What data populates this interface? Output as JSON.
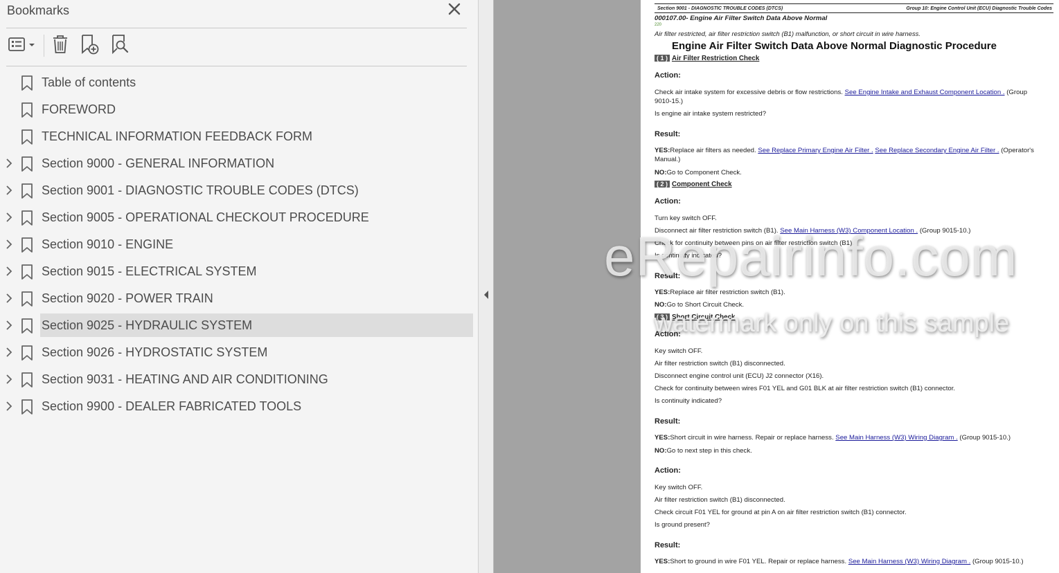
{
  "bookmarks_panel": {
    "title": "Bookmarks",
    "toolbar": {
      "options_icon": "list-options-icon",
      "delete_icon": "trash-icon",
      "add_icon": "add-bookmark-icon",
      "find_icon": "find-bookmark-icon"
    },
    "items": [
      {
        "label": "Table of contents",
        "expandable": false,
        "selected": false
      },
      {
        "label": "FOREWORD",
        "expandable": false,
        "selected": false
      },
      {
        "label": "TECHNICAL INFORMATION FEEDBACK FORM",
        "expandable": false,
        "selected": false
      },
      {
        "label": "Section 9000 - GENERAL INFORMATION",
        "expandable": true,
        "selected": false
      },
      {
        "label": "Section 9001 - DIAGNOSTIC TROUBLE CODES (DTCS)",
        "expandable": true,
        "selected": false
      },
      {
        "label": "Section 9005 - OPERATIONAL CHECKOUT PROCEDURE",
        "expandable": true,
        "selected": false
      },
      {
        "label": "Section 9010 - ENGINE",
        "expandable": true,
        "selected": false
      },
      {
        "label": "Section 9015 - ELECTRICAL SYSTEM",
        "expandable": true,
        "selected": false
      },
      {
        "label": "Section 9020 - POWER TRAIN",
        "expandable": true,
        "selected": false
      },
      {
        "label": "Section 9025 - HYDRAULIC SYSTEM",
        "expandable": true,
        "selected": true
      },
      {
        "label": "Section 9026 - HYDROSTATIC SYSTEM",
        "expandable": true,
        "selected": false
      },
      {
        "label": "Section 9031 - HEATING AND AIR CONDITIONING",
        "expandable": true,
        "selected": false
      },
      {
        "label": "Section 9900 - DEALER FABRICATED TOOLS",
        "expandable": true,
        "selected": false
      }
    ]
  },
  "document": {
    "header_left": "Section 9001 - DIAGNOSTIC TROUBLE CODES (DTCS)",
    "header_right": "Group 10: Engine Control Unit (ECU) Diagnostic Trouble Codes",
    "subtitle": "000107.00- Engine Air Filter Switch Data Above Normal",
    "code": "220",
    "description": "Air filter restricted, air filter restriction switch (B1) malfunction, or short circuit in wire harness.",
    "title": "Engine Air Filter Switch Data Above Normal Diagnostic Procedure",
    "step1": {
      "num": "( 1 )",
      "title": "Air Filter Restriction Check",
      "action_label": "Action:",
      "action_line1_a": "Check air intake system for excessive debris or flow restrictions. ",
      "action_line1_link": "See Engine Intake and Exhaust Component Location .",
      "action_line1_b": " (Group",
      "action_line2": "9010-15.)",
      "question": "Is engine air intake system restricted?",
      "result_label": "Result:",
      "yes_label": "YES:",
      "yes_a": "Replace air filters as needed. ",
      "yes_link1": "See Replace Primary Engine Air Filter .",
      "yes_link2": "See Replace Secondary Engine Air Filter .",
      "yes_b": " (Operator's",
      "yes_line2": "Manual.)",
      "no_label": "NO:",
      "no_text": "Go to Component Check."
    },
    "step2": {
      "num": "( 2 )",
      "title": "Component Check",
      "action_label": "Action:",
      "line1": "Turn key switch OFF.",
      "line2_a": "Disconnect air filter restriction switch (B1). ",
      "line2_link": "See Main Harness (W3) Component Location .",
      "line2_b": " (Group 9015-10.)",
      "line3": "Check for continuity between pins on air filter restriction switch (B1).",
      "question": "Is continuity indicated?",
      "result_label": "Result:",
      "yes_label": "YES:",
      "yes_text": "Replace air filter restriction switch (B1).",
      "no_label": "NO:",
      "no_text": "Go to Short Circuit Check."
    },
    "step3": {
      "num": "( 3 )",
      "title": "Short Circuit Check",
      "action_label": "Action:",
      "line1": "Key switch OFF.",
      "line2": "Air filter restriction switch (B1) disconnected.",
      "line3": "Disconnect engine control unit (ECU) J2 connector (X16).",
      "line4": "Check for continuity between wires F01 YEL and G01 BLK at air filter restriction switch (B1) connector.",
      "question": "Is continuity indicated?",
      "result_label": "Result:",
      "yes_label": "YES:",
      "yes_a": "Short circuit in wire harness. Repair or replace harness. ",
      "yes_link": "See Main Harness (W3) Wiring Diagram .",
      "yes_b": " (Group 9015-10.)",
      "no_label": "NO:",
      "no_text": "Go to next step in this check.",
      "action2_label": "Action:",
      "a2_line1": "Key switch OFF.",
      "a2_line2": "Air filter restriction switch (B1) disconnected.",
      "a2_line3": "Check circuit F01 YEL for ground at pin A on air filter restriction switch (B1) connector.",
      "a2_question": "Is ground present?",
      "result2_label": "Result:",
      "yes2_label": "YES:",
      "yes2_a": "Short to ground in wire F01 YEL. Repair or replace harness. ",
      "yes2_link": "See Main Harness (W3) Wiring Diagram .",
      "yes2_b": " (Group 9015-10.)"
    }
  },
  "watermark": {
    "line1": "eRepairinfo.com",
    "line2": "watermark only on this sample"
  }
}
